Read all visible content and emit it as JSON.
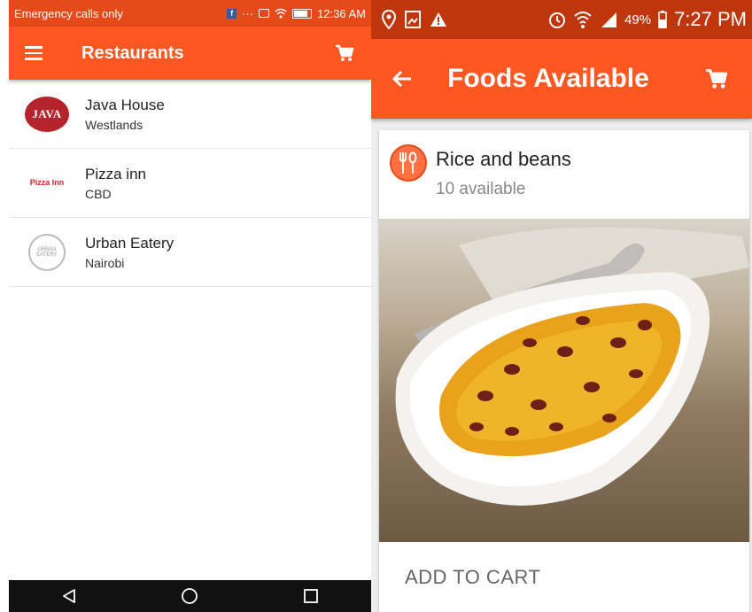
{
  "left": {
    "status_bar": {
      "carrier": "Emergency calls only",
      "time": "12:36 AM"
    },
    "toolbar": {
      "title": "Restaurants"
    },
    "restaurants": [
      {
        "name": "Java House",
        "location": "Westlands",
        "logo_text": "JAVA"
      },
      {
        "name": "Pizza inn",
        "location": "CBD",
        "logo_text": "Pizza Inn"
      },
      {
        "name": "Urban Eatery",
        "location": "Nairobi",
        "logo_text": "URBAN EATERY"
      }
    ],
    "colors": {
      "status_bar": "#e64a19",
      "toolbar": "#ff5722",
      "nav_bar": "#111111"
    }
  },
  "right": {
    "status_bar": {
      "battery": "49%",
      "time": "7:27 PM"
    },
    "toolbar": {
      "title": "Foods Available"
    },
    "food": {
      "name": "Rice and beans",
      "availability": "10 available",
      "action_label": "ADD TO CART"
    },
    "colors": {
      "status_bar": "#bf360c",
      "toolbar": "#ff5722",
      "food_icon": "#ff7043"
    }
  },
  "icons": [
    "menu-icon",
    "cart-icon",
    "back-arrow-icon",
    "fork-spoon-icon",
    "nav-back-icon",
    "nav-home-icon",
    "nav-recents-icon",
    "location-icon",
    "gallery-icon",
    "warning-icon",
    "alarm-icon",
    "wifi-icon",
    "signal-icon",
    "battery-icon"
  ]
}
